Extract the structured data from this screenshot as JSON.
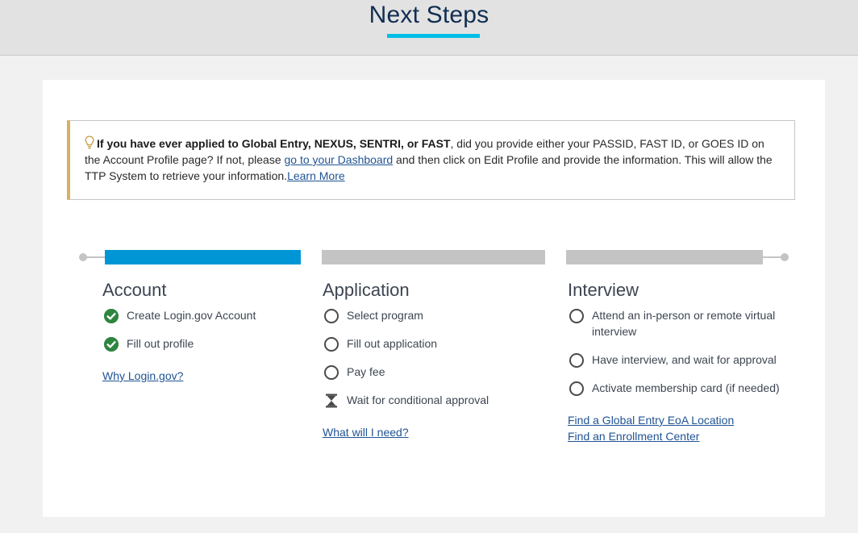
{
  "header": {
    "title": "Next Steps"
  },
  "notice": {
    "bold": "If you have ever applied to Global Entry, NEXUS, SENTRI, or FAST",
    "text_1": ", did you provide either your PASSID, FAST ID, or GOES ID on the Account Profile page? If not, please ",
    "dashboard_link": "go to your Dashboard",
    "text_2": " and then click on Edit Profile and provide the information. This will allow the TTP System to retrieve your information.",
    "learn_more": "Learn More",
    "icon": "lightbulb-icon",
    "accent_color": "#d4b25f"
  },
  "progress": {
    "active_color": "#0096d6",
    "inactive_color": "#c4c4c4",
    "steps": [
      "Account",
      "Application",
      "Interview"
    ],
    "current_step": "Account"
  },
  "account": {
    "title": "Account",
    "items": [
      {
        "label": "Create Login.gov Account",
        "status": "complete"
      },
      {
        "label": "Fill out profile",
        "status": "complete"
      }
    ],
    "link": "Why Login.gov?"
  },
  "application": {
    "title": "Application",
    "items": [
      {
        "label": "Select program",
        "status": "pending"
      },
      {
        "label": "Fill out application",
        "status": "pending"
      },
      {
        "label": "Pay fee",
        "status": "pending"
      },
      {
        "label": "Wait for conditional approval",
        "status": "waiting"
      }
    ],
    "link": "What will I need?"
  },
  "interview": {
    "title": "Interview",
    "items": [
      {
        "label": "Attend an in-person or remote virtual interview",
        "status": "pending"
      },
      {
        "label": "Have interview, and wait for approval",
        "status": "pending"
      },
      {
        "label": "Activate membership card (if needed)",
        "status": "pending"
      }
    ],
    "links": [
      "Find a Global Entry EoA Location",
      "Find an Enrollment Center"
    ]
  }
}
